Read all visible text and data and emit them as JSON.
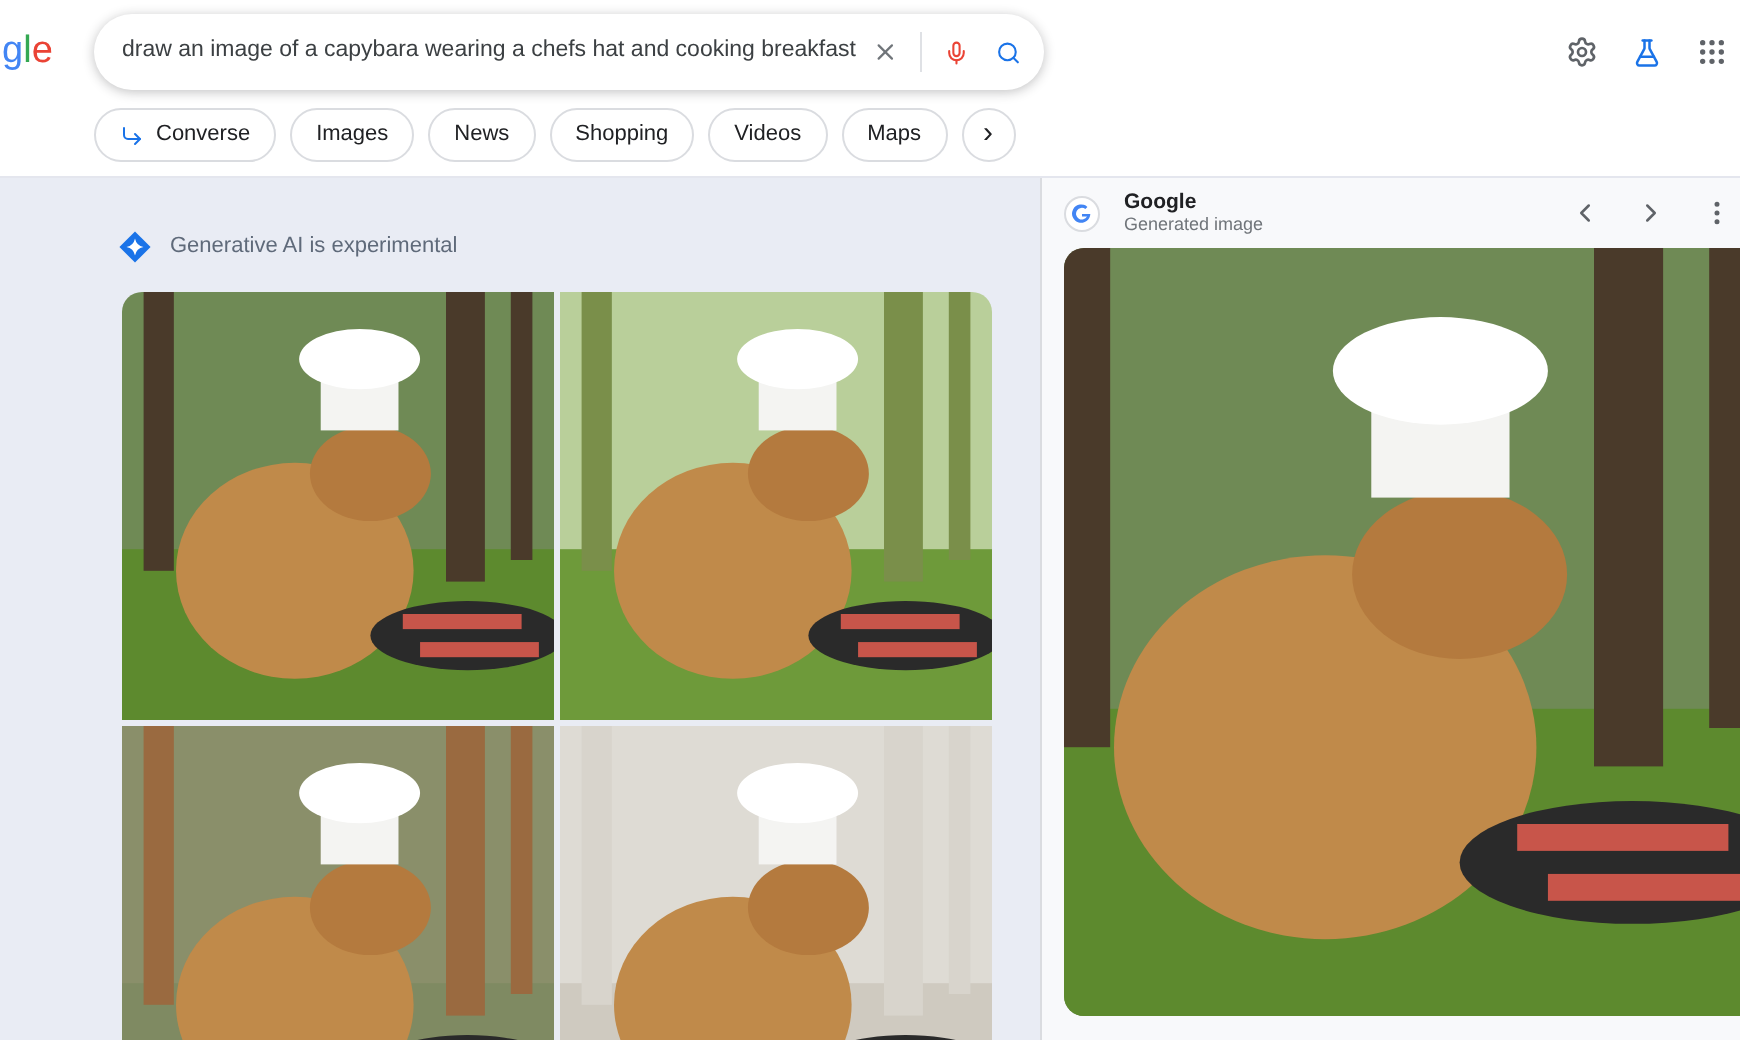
{
  "logo": {
    "letters": [
      {
        "text": "g",
        "color": "#4285f4"
      },
      {
        "text": "l",
        "color": "#34a853"
      },
      {
        "text": "e",
        "color": "#ea4335"
      }
    ]
  },
  "search": {
    "value": "draw an image of a capybara wearing a chefs hat and cooking breakfast"
  },
  "chips": [
    {
      "label": "Converse",
      "kind": "converse"
    },
    {
      "label": "Images",
      "kind": "plain"
    },
    {
      "label": "News",
      "kind": "plain"
    },
    {
      "label": "Shopping",
      "kind": "plain"
    },
    {
      "label": "Videos",
      "kind": "plain"
    },
    {
      "label": "Maps",
      "kind": "plain"
    },
    {
      "label": "›",
      "kind": "more"
    }
  ],
  "notice": {
    "text": "Generative AI is experimental"
  },
  "preview": {
    "source": "Google",
    "subtitle": "Generated image"
  }
}
